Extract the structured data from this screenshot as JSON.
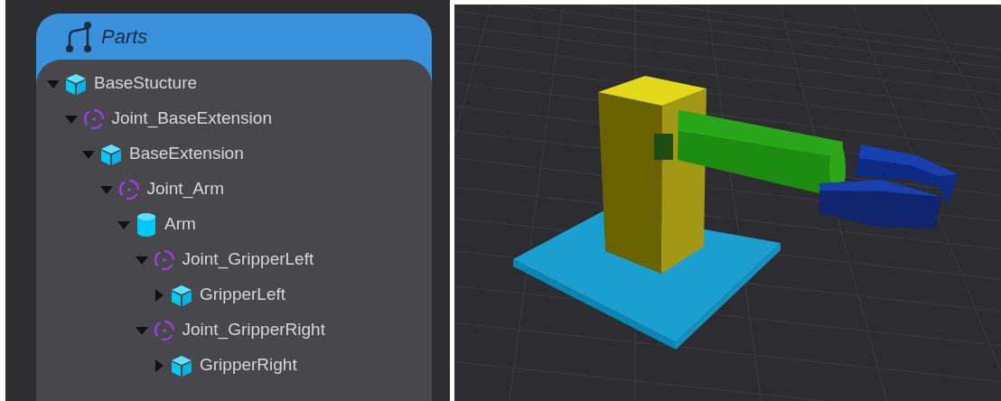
{
  "panel": {
    "title": "Parts"
  },
  "tree": [
    {
      "label": "BaseStucture",
      "kind": "cube",
      "expanded": true,
      "children": [
        {
          "label": "Joint_BaseExtension",
          "kind": "joint",
          "expanded": true,
          "children": [
            {
              "label": "BaseExtension",
              "kind": "cube",
              "expanded": true,
              "children": [
                {
                  "label": "Joint_Arm",
                  "kind": "joint",
                  "expanded": true,
                  "children": [
                    {
                      "label": "Arm",
                      "kind": "cylinder",
                      "expanded": true,
                      "children": [
                        {
                          "label": "Joint_GripperLeft",
                          "kind": "joint",
                          "expanded": true,
                          "children": [
                            {
                              "label": "GripperLeft",
                              "kind": "cube",
                              "expanded": false
                            }
                          ]
                        },
                        {
                          "label": "Joint_GripperRight",
                          "kind": "joint",
                          "expanded": true,
                          "children": [
                            {
                              "label": "GripperRight",
                              "kind": "cube",
                              "expanded": false
                            }
                          ]
                        }
                      ]
                    }
                  ]
                }
              ]
            }
          ]
        }
      ]
    }
  ]
}
